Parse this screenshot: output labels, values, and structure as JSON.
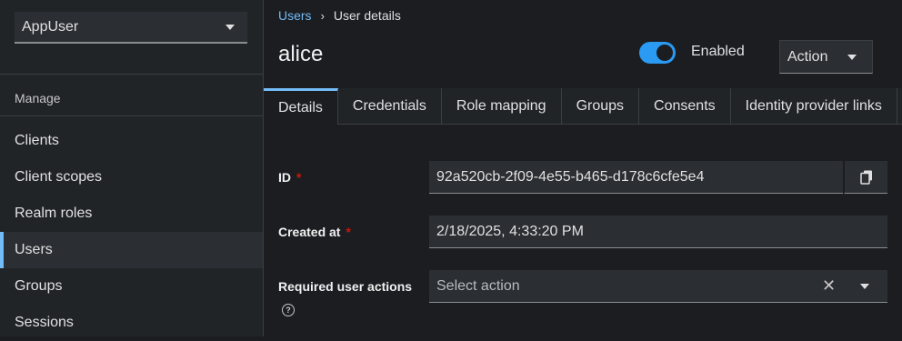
{
  "sidebar": {
    "realm": "AppUser",
    "section_title": "Manage",
    "items": [
      {
        "label": "Clients"
      },
      {
        "label": "Client scopes"
      },
      {
        "label": "Realm roles"
      },
      {
        "label": "Users"
      },
      {
        "label": "Groups"
      },
      {
        "label": "Sessions"
      }
    ],
    "active_item": "Users"
  },
  "breadcrumb": {
    "parent": "Users",
    "separator": "›",
    "current": "User details"
  },
  "header": {
    "title": "alice",
    "enabled_label": "Enabled",
    "enabled": true,
    "action_label": "Action"
  },
  "tabs": [
    {
      "label": "Details",
      "active": true
    },
    {
      "label": "Credentials"
    },
    {
      "label": "Role mapping"
    },
    {
      "label": "Groups"
    },
    {
      "label": "Consents"
    },
    {
      "label": "Identity provider links"
    }
  ],
  "form": {
    "id_label": "ID",
    "id_value": "92a520cb-2f09-4e55-b465-d178c6cfe5e4",
    "created_label": "Created at",
    "created_value": "2/18/2025, 4:33:20 PM",
    "required_mark": "*",
    "actions_label": "Required user actions",
    "actions_placeholder": "Select action",
    "clear_glyph": "✕",
    "help_glyph": "?"
  },
  "colors": {
    "accent": "#73bcf7",
    "toggle_on": "#2b9af3",
    "required": "#c9190b"
  }
}
